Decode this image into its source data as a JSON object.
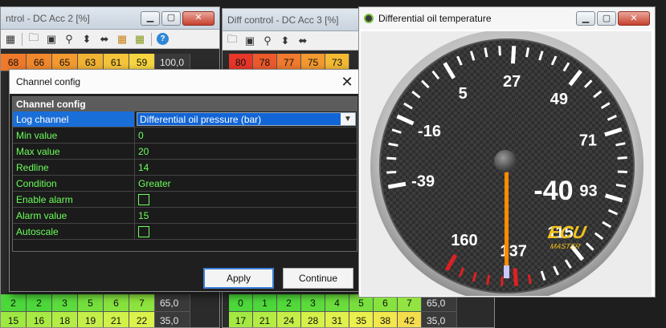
{
  "win1": {
    "title": "ntrol - DC Acc 2 [%]",
    "rows": [
      [
        "68",
        "66",
        "65",
        "63",
        "61",
        "59",
        "100,0"
      ],
      [
        "2",
        "2",
        "3",
        "5",
        "6",
        "7",
        "65,0"
      ],
      [
        "15",
        "16",
        "18",
        "19",
        "21",
        "22",
        "35,0"
      ]
    ],
    "row_colors": [
      [
        "#f07a2a",
        "#f2882c",
        "#f49a30",
        "#f2b233",
        "#f4c43a",
        "#f6d640"
      ],
      [
        "#4cd83a",
        "#4cd83a",
        "#5cdc3c",
        "#74e03c",
        "#86e23e",
        "#8ee43e"
      ],
      [
        "#9ee842",
        "#a8ea44",
        "#b4ec46",
        "#c4ee48",
        "#d0f04a",
        "#dcf24c"
      ]
    ]
  },
  "win2": {
    "title": "Diff control - DC Acc 3 [%]",
    "rows": [
      [
        "80",
        "78",
        "77",
        "75",
        "73"
      ],
      [
        "0",
        "1",
        "2",
        "3",
        "4",
        "5",
        "6",
        "7",
        "65,0"
      ],
      [
        "17",
        "21",
        "24",
        "28",
        "31",
        "35",
        "38",
        "42",
        "35,0"
      ]
    ],
    "row_colors": [
      [
        "#e8362a",
        "#ec5a2c",
        "#f07a2e",
        "#f29a30",
        "#f4ba34"
      ],
      [
        "#4cd83a",
        "#4cd83a",
        "#52da3a",
        "#5cdc3c",
        "#6ade3c",
        "#78e03e",
        "#86e23e",
        "#92e440"
      ],
      [
        "#a4e844",
        "#b4ec46",
        "#c6ee48",
        "#d4f04a",
        "#e0f04c",
        "#ecf04e",
        "#f2e84e",
        "#f4dc4c"
      ]
    ]
  },
  "dialog": {
    "title": "Channel config",
    "section": "Channel config",
    "rows": [
      {
        "key": "Log channel",
        "value": "Differential oil pressure (bar)"
      },
      {
        "key": "Min value",
        "value": "0"
      },
      {
        "key": "Max value",
        "value": "20"
      },
      {
        "key": "Redline",
        "value": "14"
      },
      {
        "key": "Condition",
        "value": "Greater"
      },
      {
        "key": "Enable alarm",
        "value": ""
      },
      {
        "key": "Alarm value",
        "value": "15"
      },
      {
        "key": "Autoscale",
        "value": ""
      }
    ],
    "apply_label": "Apply",
    "continue_label": "Continue"
  },
  "gauge": {
    "title": "Differential oil temperature",
    "value": "-40",
    "labels": [
      "-39",
      "-16",
      "5",
      "27",
      "49",
      "71",
      "93",
      "115",
      "137",
      "160"
    ],
    "brand": "ECU",
    "brand_sub": "MASTER",
    "accent": "#ff8c00",
    "redline_color": "#e02020"
  }
}
